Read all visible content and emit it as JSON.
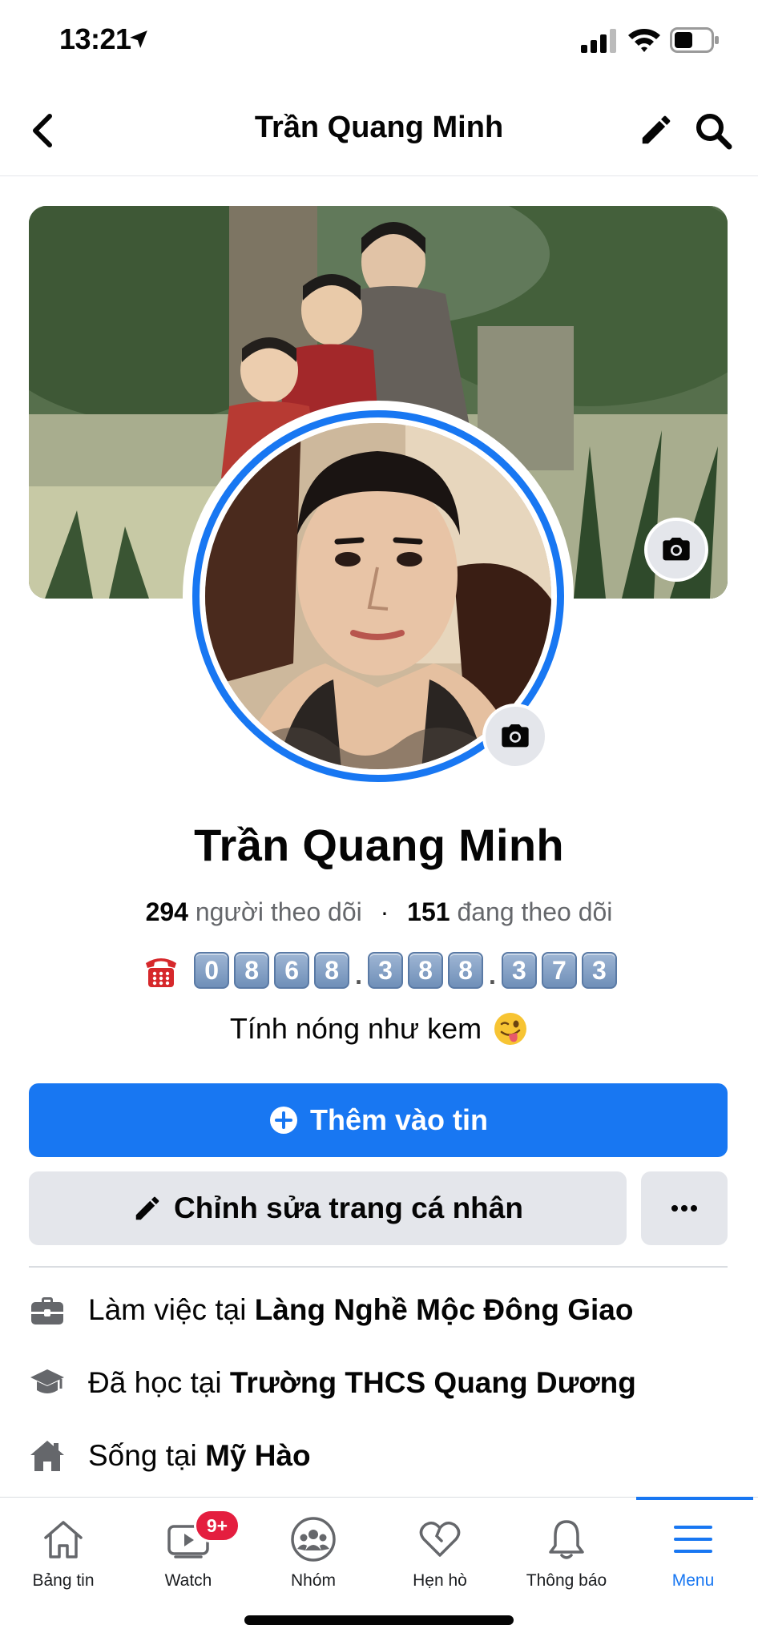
{
  "status_bar": {
    "time": "13:21"
  },
  "header": {
    "title": "Trần Quang Minh"
  },
  "profile": {
    "name": "Trần Quang Minh",
    "followers_count": "294",
    "followers_label": "người theo dõi",
    "following_count": "151",
    "following_label": "đang theo dõi",
    "phone_groups": [
      [
        "0",
        "8",
        "6",
        "8"
      ],
      [
        "3",
        "8",
        "8"
      ],
      [
        "3",
        "7",
        "3"
      ]
    ],
    "phone_separator": ".",
    "bio": "Tính nóng như kem"
  },
  "actions": {
    "add_story": "Thêm vào tin",
    "edit_profile": "Chỉnh sửa trang cá nhân",
    "more": "..."
  },
  "details": [
    {
      "icon": "briefcase-icon",
      "prefix": "Làm việc tại",
      "value": "Làng Nghề Mộc Đông Giao"
    },
    {
      "icon": "graduation-cap-icon",
      "prefix": "Đã học tại",
      "value": "Trường THCS Quang Dương"
    },
    {
      "icon": "home-icon",
      "prefix": "Sống tại",
      "value": "Mỹ Hào"
    }
  ],
  "bottom_nav": {
    "items": [
      {
        "label": "Bảng tin",
        "icon": "home-icon"
      },
      {
        "label": "Watch",
        "icon": "watch-icon",
        "badge": "9+"
      },
      {
        "label": "Nhóm",
        "icon": "groups-icon"
      },
      {
        "label": "Hẹn hò",
        "icon": "dating-heart-icon"
      },
      {
        "label": "Thông báo",
        "icon": "bell-icon"
      },
      {
        "label": "Menu",
        "icon": "menu-icon",
        "active": true
      }
    ]
  },
  "colors": {
    "accent": "#1877f2",
    "button_gray": "#e4e6eb",
    "badge_red": "#e41e3f"
  }
}
